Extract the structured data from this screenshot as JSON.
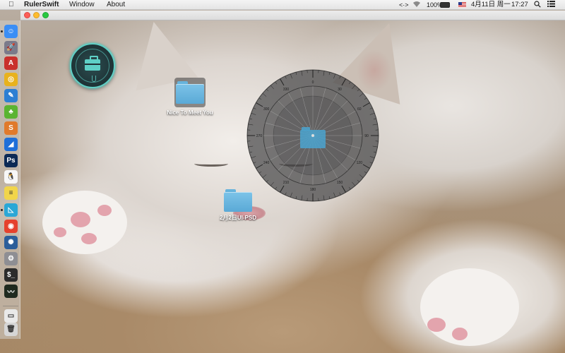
{
  "menubar": {
    "apple_icon": "apple-icon",
    "app_name": "RulerSwift",
    "menus": [
      "Window",
      "About"
    ],
    "network_icon": "<·>",
    "wifi_icon": "wifi-icon",
    "battery_percent": "100%",
    "battery_icon": "battery-icon",
    "input_source_icon": "us-flag-icon",
    "date": "4月11日 周一",
    "time": "17:27",
    "search_icon": "🔍",
    "notification_icon": "☰"
  },
  "window": {
    "buttons": [
      "close",
      "minimize",
      "maximize"
    ],
    "colors": {
      "close": "#fc5f57",
      "minimize": "#fdbc2e",
      "maximize": "#28c840"
    }
  },
  "dock": {
    "items": [
      {
        "name": "finder",
        "glyph": "☺",
        "color": "#3a8ef5",
        "running": true
      },
      {
        "name": "launchpad",
        "glyph": "🚀",
        "color": "#7a7a8a",
        "running": false
      },
      {
        "name": "acrobat",
        "glyph": "A",
        "color": "#c9302c",
        "running": false
      },
      {
        "name": "chrome",
        "glyph": "◎",
        "color": "#e8b21d",
        "running": false
      },
      {
        "name": "xcode",
        "glyph": "✎",
        "color": "#2d7fd3",
        "running": false
      },
      {
        "name": "evernote",
        "glyph": "♣",
        "color": "#5ab431",
        "running": false
      },
      {
        "name": "sublime",
        "glyph": "S",
        "color": "#e07a2c",
        "running": false
      },
      {
        "name": "lark",
        "glyph": "◢",
        "color": "#1e6fd9",
        "running": false
      },
      {
        "name": "photoshop",
        "glyph": "Ps",
        "color": "#0c2a55",
        "running": false
      },
      {
        "name": "qq",
        "glyph": "🐧",
        "color": "#f7f7f7",
        "running": false
      },
      {
        "name": "stickies",
        "glyph": "≡",
        "color": "#f1d54a",
        "running": false
      },
      {
        "name": "rulerswift",
        "glyph": "◺",
        "color": "#2aa7d6",
        "running": true
      },
      {
        "name": "weibo",
        "glyph": "◉",
        "color": "#e5412d",
        "running": false
      },
      {
        "name": "cleaner",
        "glyph": "✺",
        "color": "#2b5e9a",
        "running": false
      },
      {
        "name": "system-preferences",
        "glyph": "⚙",
        "color": "#8e8e93",
        "running": false
      },
      {
        "name": "terminal",
        "glyph": "$_",
        "color": "#2b2b2b",
        "running": false
      },
      {
        "name": "activity-monitor",
        "glyph": "〰",
        "color": "#1f2a1f",
        "running": false
      },
      {
        "name": "preview",
        "glyph": "▭",
        "color": "#e9e9e9",
        "running": false
      },
      {
        "name": "trash",
        "glyph": "🗑",
        "color": "#d6d6d6",
        "running": false
      }
    ]
  },
  "widget": {
    "icon": "toolbox-icon",
    "accent": "#5ed0c6"
  },
  "desktop": {
    "items": [
      {
        "label": "Nice To Meet You",
        "icon": "folder-icon",
        "selected": true
      },
      {
        "label": "2月2日UI-PSD",
        "icon": "folder-icon",
        "selected": false
      }
    ]
  },
  "protractor": {
    "tick_labels": [
      "0",
      "30",
      "60",
      "90",
      "120",
      "150",
      "180",
      "210",
      "240",
      "270",
      "300",
      "330"
    ]
  }
}
